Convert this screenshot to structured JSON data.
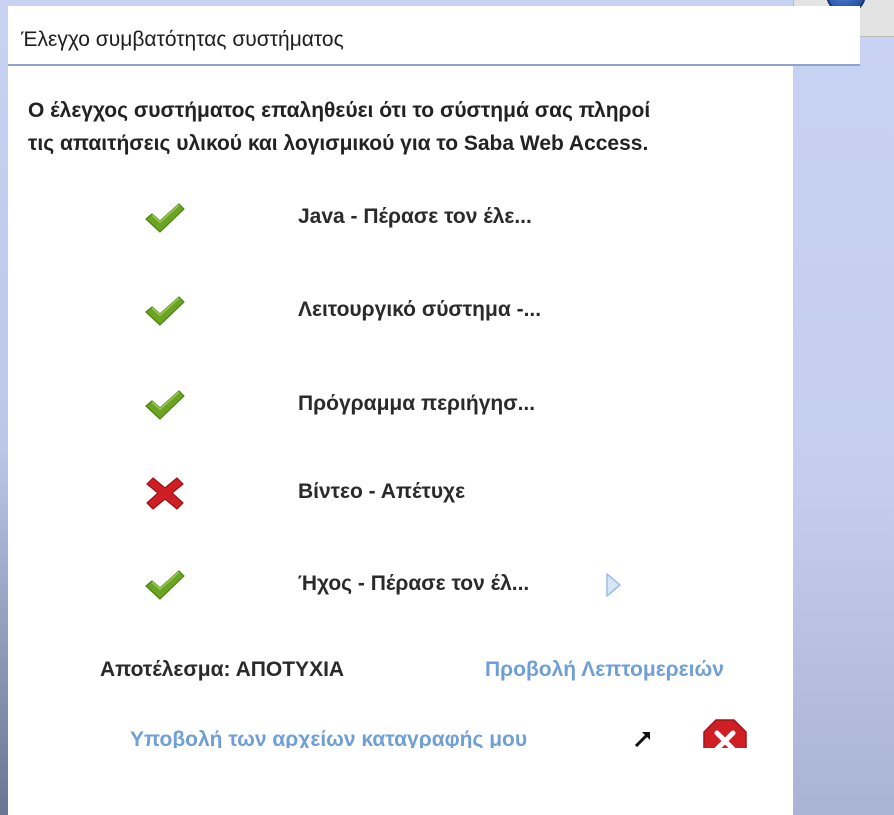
{
  "dialog": {
    "title": "Έλεγχο συμβατότητας συστήματος",
    "intro_line1": "Ο έλεγχος συστήματος επαληθεύει ότι το σύστημά σας πληροί",
    "intro_line2": "τις απαιτήσεις υλικού και λογισμικού για το Saba Web Access."
  },
  "checks": [
    {
      "label": "Java - Πέρασε τον έλε...",
      "status": "pass",
      "icon": "checkmark-icon"
    },
    {
      "label": "Λειτουργικό σύστημα -...",
      "status": "pass",
      "icon": "checkmark-icon"
    },
    {
      "label": "Πρόγραμμα περιήγησ...",
      "status": "pass",
      "icon": "checkmark-icon"
    },
    {
      "label": "Βίντεο - Απέτυχε",
      "status": "fail",
      "icon": "cross-icon"
    },
    {
      "label": "Ήχος - Πέρασε τον έλ...",
      "status": "pass",
      "icon": "checkmark-icon"
    }
  ],
  "result": {
    "label": "Αποτέλεσμα: ΑΠΟΤΥΧΙΑ",
    "details_link": "Προβολή Λεπτομερειών"
  },
  "footer": {
    "submit_link": "Υποβολή των αρχείων καταγραφής μου"
  },
  "colors": {
    "link": "#6f9fd6",
    "pass": "#6aa421",
    "fail": "#cf1f25",
    "header_border": "#8ea3c9"
  }
}
